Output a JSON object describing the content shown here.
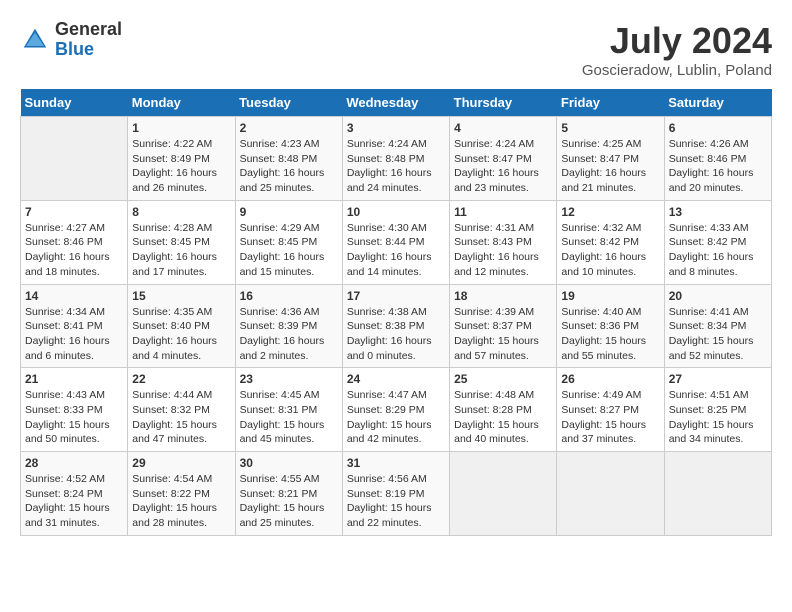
{
  "header": {
    "logo_general": "General",
    "logo_blue": "Blue",
    "month_year": "July 2024",
    "location": "Goscieradow, Lublin, Poland"
  },
  "calendar": {
    "days_of_week": [
      "Sunday",
      "Monday",
      "Tuesday",
      "Wednesday",
      "Thursday",
      "Friday",
      "Saturday"
    ],
    "weeks": [
      [
        {
          "day": "",
          "info": ""
        },
        {
          "day": "1",
          "info": "Sunrise: 4:22 AM\nSunset: 8:49 PM\nDaylight: 16 hours\nand 26 minutes."
        },
        {
          "day": "2",
          "info": "Sunrise: 4:23 AM\nSunset: 8:48 PM\nDaylight: 16 hours\nand 25 minutes."
        },
        {
          "day": "3",
          "info": "Sunrise: 4:24 AM\nSunset: 8:48 PM\nDaylight: 16 hours\nand 24 minutes."
        },
        {
          "day": "4",
          "info": "Sunrise: 4:24 AM\nSunset: 8:47 PM\nDaylight: 16 hours\nand 23 minutes."
        },
        {
          "day": "5",
          "info": "Sunrise: 4:25 AM\nSunset: 8:47 PM\nDaylight: 16 hours\nand 21 minutes."
        },
        {
          "day": "6",
          "info": "Sunrise: 4:26 AM\nSunset: 8:46 PM\nDaylight: 16 hours\nand 20 minutes."
        }
      ],
      [
        {
          "day": "7",
          "info": "Sunrise: 4:27 AM\nSunset: 8:46 PM\nDaylight: 16 hours\nand 18 minutes."
        },
        {
          "day": "8",
          "info": "Sunrise: 4:28 AM\nSunset: 8:45 PM\nDaylight: 16 hours\nand 17 minutes."
        },
        {
          "day": "9",
          "info": "Sunrise: 4:29 AM\nSunset: 8:45 PM\nDaylight: 16 hours\nand 15 minutes."
        },
        {
          "day": "10",
          "info": "Sunrise: 4:30 AM\nSunset: 8:44 PM\nDaylight: 16 hours\nand 14 minutes."
        },
        {
          "day": "11",
          "info": "Sunrise: 4:31 AM\nSunset: 8:43 PM\nDaylight: 16 hours\nand 12 minutes."
        },
        {
          "day": "12",
          "info": "Sunrise: 4:32 AM\nSunset: 8:42 PM\nDaylight: 16 hours\nand 10 minutes."
        },
        {
          "day": "13",
          "info": "Sunrise: 4:33 AM\nSunset: 8:42 PM\nDaylight: 16 hours\nand 8 minutes."
        }
      ],
      [
        {
          "day": "14",
          "info": "Sunrise: 4:34 AM\nSunset: 8:41 PM\nDaylight: 16 hours\nand 6 minutes."
        },
        {
          "day": "15",
          "info": "Sunrise: 4:35 AM\nSunset: 8:40 PM\nDaylight: 16 hours\nand 4 minutes."
        },
        {
          "day": "16",
          "info": "Sunrise: 4:36 AM\nSunset: 8:39 PM\nDaylight: 16 hours\nand 2 minutes."
        },
        {
          "day": "17",
          "info": "Sunrise: 4:38 AM\nSunset: 8:38 PM\nDaylight: 16 hours\nand 0 minutes."
        },
        {
          "day": "18",
          "info": "Sunrise: 4:39 AM\nSunset: 8:37 PM\nDaylight: 15 hours\nand 57 minutes."
        },
        {
          "day": "19",
          "info": "Sunrise: 4:40 AM\nSunset: 8:36 PM\nDaylight: 15 hours\nand 55 minutes."
        },
        {
          "day": "20",
          "info": "Sunrise: 4:41 AM\nSunset: 8:34 PM\nDaylight: 15 hours\nand 52 minutes."
        }
      ],
      [
        {
          "day": "21",
          "info": "Sunrise: 4:43 AM\nSunset: 8:33 PM\nDaylight: 15 hours\nand 50 minutes."
        },
        {
          "day": "22",
          "info": "Sunrise: 4:44 AM\nSunset: 8:32 PM\nDaylight: 15 hours\nand 47 minutes."
        },
        {
          "day": "23",
          "info": "Sunrise: 4:45 AM\nSunset: 8:31 PM\nDaylight: 15 hours\nand 45 minutes."
        },
        {
          "day": "24",
          "info": "Sunrise: 4:47 AM\nSunset: 8:29 PM\nDaylight: 15 hours\nand 42 minutes."
        },
        {
          "day": "25",
          "info": "Sunrise: 4:48 AM\nSunset: 8:28 PM\nDaylight: 15 hours\nand 40 minutes."
        },
        {
          "day": "26",
          "info": "Sunrise: 4:49 AM\nSunset: 8:27 PM\nDaylight: 15 hours\nand 37 minutes."
        },
        {
          "day": "27",
          "info": "Sunrise: 4:51 AM\nSunset: 8:25 PM\nDaylight: 15 hours\nand 34 minutes."
        }
      ],
      [
        {
          "day": "28",
          "info": "Sunrise: 4:52 AM\nSunset: 8:24 PM\nDaylight: 15 hours\nand 31 minutes."
        },
        {
          "day": "29",
          "info": "Sunrise: 4:54 AM\nSunset: 8:22 PM\nDaylight: 15 hours\nand 28 minutes."
        },
        {
          "day": "30",
          "info": "Sunrise: 4:55 AM\nSunset: 8:21 PM\nDaylight: 15 hours\nand 25 minutes."
        },
        {
          "day": "31",
          "info": "Sunrise: 4:56 AM\nSunset: 8:19 PM\nDaylight: 15 hours\nand 22 minutes."
        },
        {
          "day": "",
          "info": ""
        },
        {
          "day": "",
          "info": ""
        },
        {
          "day": "",
          "info": ""
        }
      ]
    ]
  }
}
